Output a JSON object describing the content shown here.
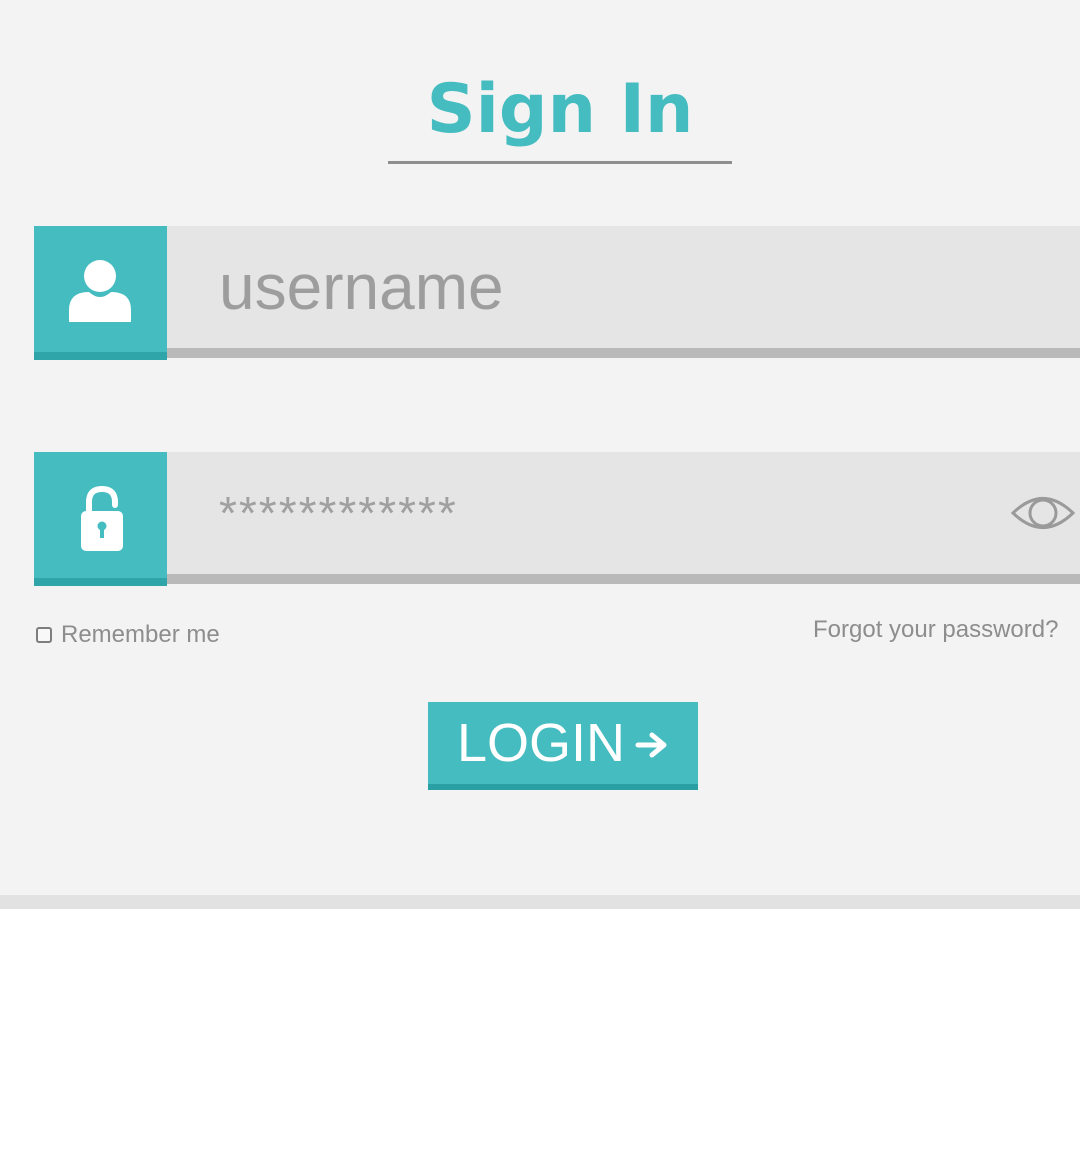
{
  "header": {
    "title": "Sign In"
  },
  "form": {
    "username": {
      "placeholder": "username",
      "icon": "user-icon"
    },
    "password": {
      "placeholder": "************",
      "icon": "lock-icon",
      "toggle_icon": "eye-icon"
    },
    "remember_label": "Remember me",
    "forgot_label": "Forgot your password?",
    "login_label": "LOGIN",
    "login_icon": "arrow-right-icon"
  },
  "colors": {
    "accent": "#45bcc0",
    "field_background": "#e5e5e5",
    "card_background": "#f3f3f3",
    "muted_text": "#8d8d8d"
  }
}
